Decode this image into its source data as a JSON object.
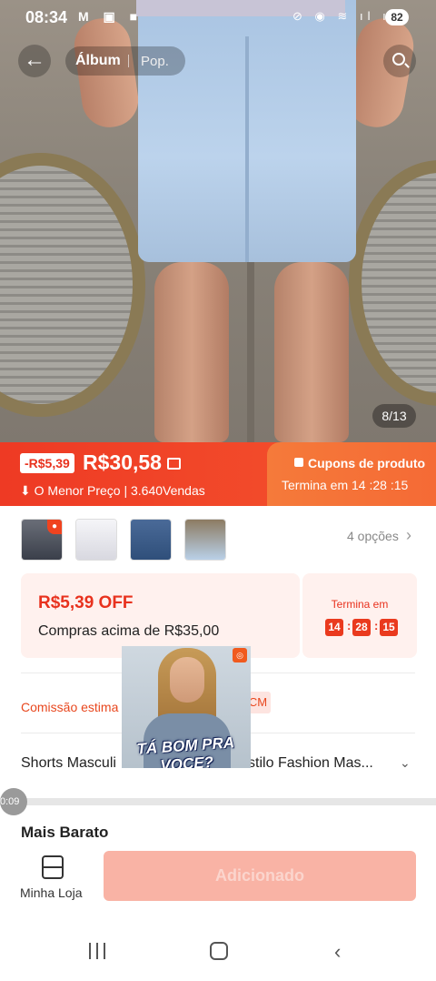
{
  "status_bar": {
    "time": "08:34",
    "left_icons": "M ▣ ■",
    "right_icons": "⊘ ◉ ≋ ıl ıl",
    "battery": "82"
  },
  "gallery": {
    "back_icon": "arrow-left-icon",
    "tabs": [
      "Álbum",
      "Pop."
    ],
    "search_icon": "search-icon",
    "counter": "8/13"
  },
  "price_banner": {
    "discount_badge": "-R$5,39",
    "price": "R$30,58",
    "lowest_price_label": "O Menor Preço",
    "sales": "3.640Vendas",
    "coupons_title": "Cupons de produto",
    "countdown": "Termina em 14 :28 :15",
    "colors": {
      "banner": "#ee3a24",
      "accent": "#e8321e"
    }
  },
  "variants": {
    "options_label": "4 opções",
    "thumb_colors": [
      "#3a3f4a",
      "#e9e9ee",
      "#2f4f7a",
      "#b9d0e8"
    ]
  },
  "offer": {
    "amount": "R$5,39 OFF",
    "condition": "Compras acima de R$35,00",
    "timer_label": "Termina em",
    "timer": {
      "h": "14",
      "m": "28",
      "s": "15"
    }
  },
  "commission": {
    "label": "Comissão estima",
    "badge": "CM"
  },
  "product": {
    "title_start": "Shorts Masculi",
    "title_end": "s Estilo Fashion Mas...",
    "video_caption": "TÁ BOM PRA VOCE?"
  },
  "video": {
    "time": "0:09"
  },
  "section": {
    "title": "Mais Barato"
  },
  "bottom_bar": {
    "store_label": "Minha Loja",
    "add_button": "Adicionado"
  }
}
